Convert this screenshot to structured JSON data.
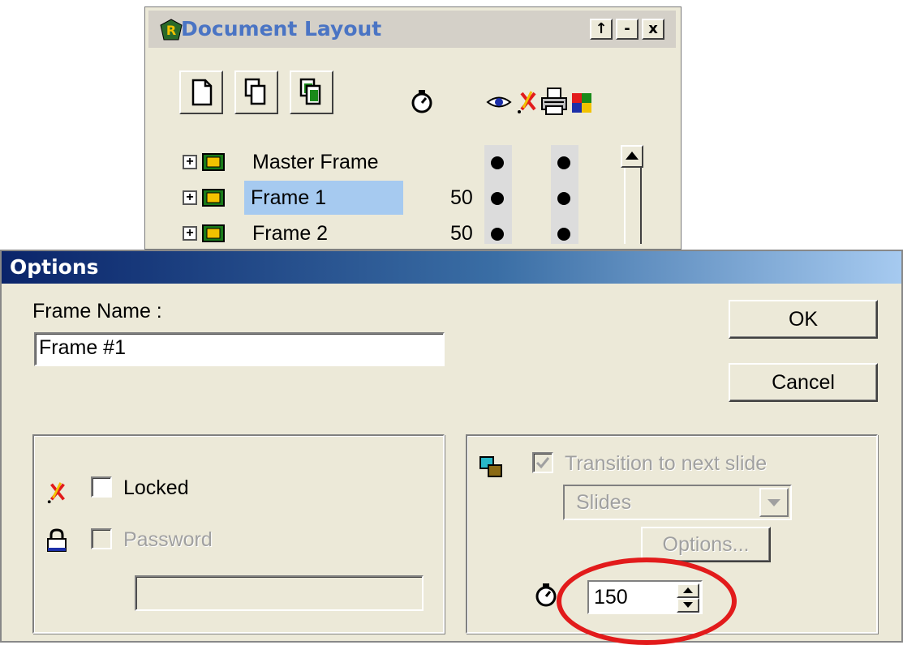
{
  "document_layout": {
    "title": "Document Layout",
    "window_controls": {
      "restore": "↑",
      "minimize": "-",
      "close": "x"
    },
    "toolbar": [
      {
        "name": "new-frame",
        "icon": "blank-page-icon"
      },
      {
        "name": "duplicate-frame",
        "icon": "copy-pages-icon"
      },
      {
        "name": "frame-from-image",
        "icon": "copy-pages-green-icon"
      }
    ],
    "column_icons": [
      "stopwatch-icon",
      "eye-icon",
      "pencil-locked-icon",
      "printer-icon",
      "color-squares-icon"
    ],
    "frames": [
      {
        "label": "Master Frame",
        "delay": "",
        "visible": true,
        "printable": true,
        "selected": false
      },
      {
        "label": "Frame 1",
        "delay": "50",
        "visible": true,
        "printable": true,
        "selected": true
      },
      {
        "label": "Frame 2",
        "delay": "50",
        "visible": true,
        "printable": true,
        "selected": false
      }
    ]
  },
  "options": {
    "title": "Options",
    "frame_name_label": "Frame Name :",
    "frame_name_value": "Frame #1",
    "ok_label": "OK",
    "cancel_label": "Cancel",
    "locked_label": "Locked",
    "locked_checked": false,
    "password_label": "Password",
    "password_checked": false,
    "password_value": "",
    "transition_label": "Transition to next slide",
    "transition_checked": true,
    "transition_type": "Slides",
    "options_button_label": "Options...",
    "delay_value": "150",
    "highlight_color": "#e21b1b"
  }
}
